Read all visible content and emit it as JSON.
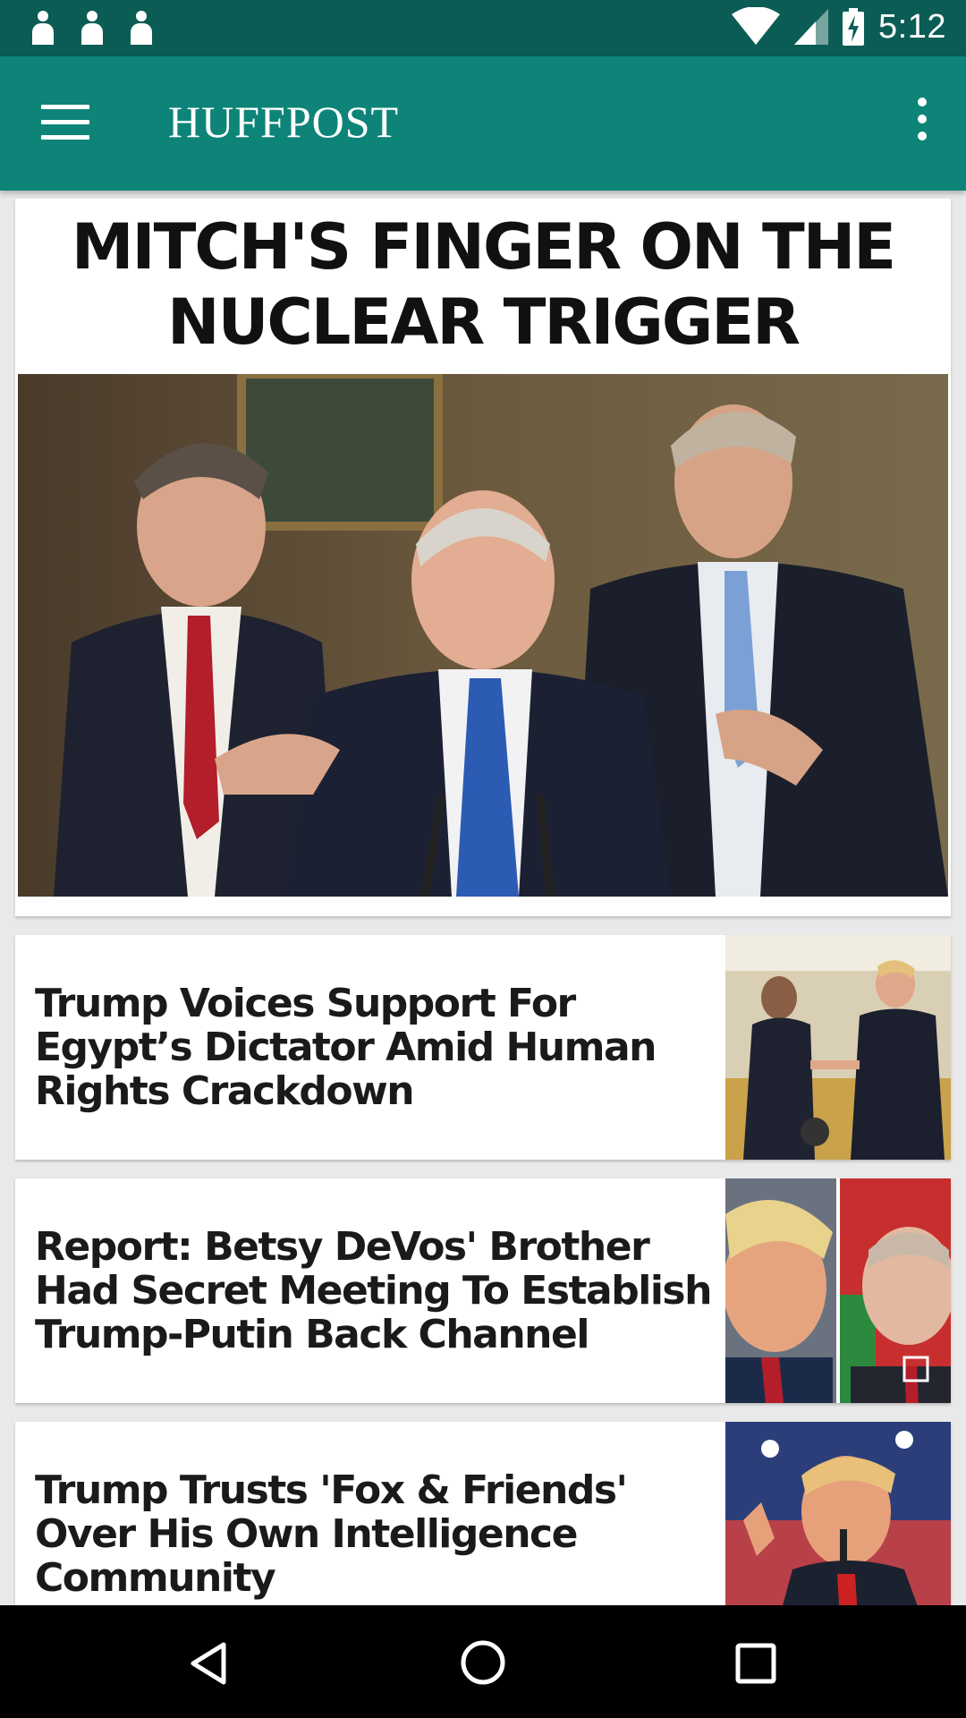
{
  "status_bar": {
    "time": "5:12",
    "left_icons": [
      "notification-person-icon",
      "notification-person-icon",
      "notification-person-icon"
    ],
    "right_icons": [
      "wifi-icon",
      "cell-signal-icon",
      "battery-charging-icon"
    ]
  },
  "app_bar": {
    "title": "HUFFPOST",
    "menu_icon": "hamburger-menu-icon",
    "overflow_icon": "overflow-menu-icon",
    "color": "#0e8478"
  },
  "lead_story": {
    "headline_line1": "MITCH'S FINGER ON THE",
    "headline_line2": "NUCLEAR TRIGGER"
  },
  "stories": [
    {
      "headline": "Trump Voices Support For Egypt’s Dictator Amid Human Rights Crackdown"
    },
    {
      "headline": "Report: Betsy DeVos' Brother Had Secret Meeting To Establish Trump-Putin Back Channel"
    },
    {
      "headline": "Trump Trusts 'Fox & Friends' Over His Own Intelligence Community"
    }
  ],
  "nav_bar": {
    "icons": [
      "back-icon",
      "home-icon",
      "recents-icon"
    ]
  }
}
